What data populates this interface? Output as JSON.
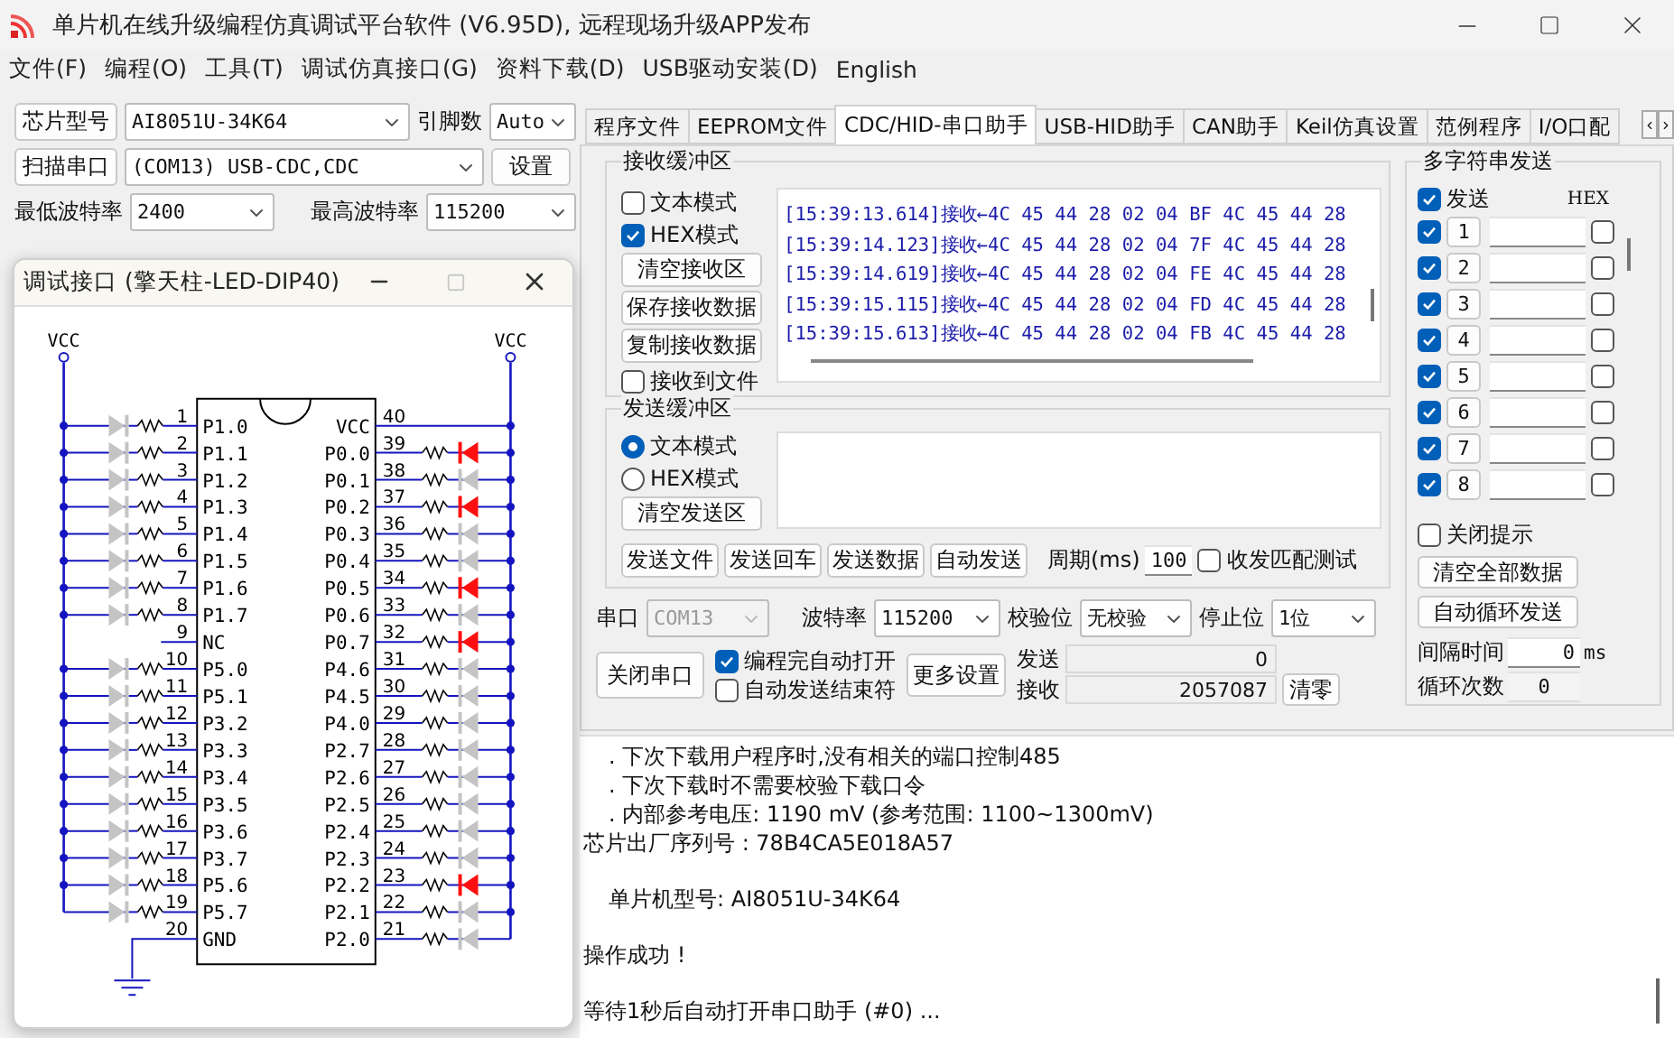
{
  "window": {
    "title": "单片机在线升级编程仿真调试平台软件 (V6.95D), 远程现场升级APP发布"
  },
  "menu": [
    "文件(F)",
    "编程(O)",
    "工具(T)",
    "调试仿真接口(G)",
    "资料下载(D)",
    "USB驱动安装(D)",
    "English"
  ],
  "left_panel": {
    "chip_button": "芯片型号",
    "chip_select": "AI8051U-34K64",
    "pin_count_label": "引脚数",
    "pin_count_select": "Auto",
    "scan_button": "扫描串口",
    "port_select": "(COM13) USB-CDC,CDC",
    "settings_button": "设置",
    "min_baud_label": "最低波特率",
    "min_baud_select": "2400",
    "max_baud_label": "最高波特率",
    "max_baud_select": "115200"
  },
  "debug_window": {
    "title": "调试接口 (擎天柱-LED-DIP40)",
    "vcc_labels": [
      "VCC",
      "VCC"
    ],
    "left_pins": [
      {
        "number": "1",
        "label": "P1.0",
        "kind": "led",
        "on": false
      },
      {
        "number": "2",
        "label": "P1.1",
        "kind": "led",
        "on": false
      },
      {
        "number": "3",
        "label": "P1.2",
        "kind": "led",
        "on": false
      },
      {
        "number": "4",
        "label": "P1.3",
        "kind": "led",
        "on": false
      },
      {
        "number": "5",
        "label": "P1.4",
        "kind": "led",
        "on": false
      },
      {
        "number": "6",
        "label": "P1.5",
        "kind": "led",
        "on": false
      },
      {
        "number": "7",
        "label": "P1.6",
        "kind": "led",
        "on": false
      },
      {
        "number": "8",
        "label": "P1.7",
        "kind": "led",
        "on": false
      },
      {
        "number": "9",
        "label": "NC",
        "kind": "open"
      },
      {
        "number": "10",
        "label": "P5.0",
        "kind": "led",
        "on": false
      },
      {
        "number": "11",
        "label": "P5.1",
        "kind": "led",
        "on": false
      },
      {
        "number": "12",
        "label": "P3.2",
        "kind": "led",
        "on": false
      },
      {
        "number": "13",
        "label": "P3.3",
        "kind": "led",
        "on": false
      },
      {
        "number": "14",
        "label": "P3.4",
        "kind": "led",
        "on": false
      },
      {
        "number": "15",
        "label": "P3.5",
        "kind": "led",
        "on": false
      },
      {
        "number": "16",
        "label": "P3.6",
        "kind": "led",
        "on": false
      },
      {
        "number": "17",
        "label": "P3.7",
        "kind": "led",
        "on": false
      },
      {
        "number": "18",
        "label": "P5.6",
        "kind": "led",
        "on": false
      },
      {
        "number": "19",
        "label": "P5.7",
        "kind": "led",
        "on": false
      },
      {
        "number": "20",
        "label": "GND",
        "kind": "ground"
      }
    ],
    "right_pins": [
      {
        "number": "40",
        "label": "VCC",
        "kind": "supply"
      },
      {
        "number": "39",
        "label": "P0.0",
        "kind": "led",
        "on": true
      },
      {
        "number": "38",
        "label": "P0.1",
        "kind": "led",
        "on": false
      },
      {
        "number": "37",
        "label": "P0.2",
        "kind": "led",
        "on": true
      },
      {
        "number": "36",
        "label": "P0.3",
        "kind": "led",
        "on": false
      },
      {
        "number": "35",
        "label": "P0.4",
        "kind": "led",
        "on": false
      },
      {
        "number": "34",
        "label": "P0.5",
        "kind": "led",
        "on": true
      },
      {
        "number": "33",
        "label": "P0.6",
        "kind": "led",
        "on": false
      },
      {
        "number": "32",
        "label": "P0.7",
        "kind": "led",
        "on": true
      },
      {
        "number": "31",
        "label": "P4.6",
        "kind": "led",
        "on": false
      },
      {
        "number": "30",
        "label": "P4.5",
        "kind": "led",
        "on": false
      },
      {
        "number": "29",
        "label": "P4.0",
        "kind": "led",
        "on": false
      },
      {
        "number": "28",
        "label": "P2.7",
        "kind": "led",
        "on": false
      },
      {
        "number": "27",
        "label": "P2.6",
        "kind": "led",
        "on": false
      },
      {
        "number": "26",
        "label": "P2.5",
        "kind": "led",
        "on": false
      },
      {
        "number": "25",
        "label": "P2.4",
        "kind": "led",
        "on": false
      },
      {
        "number": "24",
        "label": "P2.3",
        "kind": "led",
        "on": false
      },
      {
        "number": "23",
        "label": "P2.2",
        "kind": "led",
        "on": true
      },
      {
        "number": "22",
        "label": "P2.1",
        "kind": "led",
        "on": false
      },
      {
        "number": "21",
        "label": "P2.0",
        "kind": "led",
        "on": false
      }
    ]
  },
  "tabs": [
    {
      "label": "程序文件",
      "selected": false
    },
    {
      "label": "EEPROM文件",
      "selected": false
    },
    {
      "label": "CDC/HID-串口助手",
      "selected": true
    },
    {
      "label": "USB-HID助手",
      "selected": false
    },
    {
      "label": "CAN助手",
      "selected": false
    },
    {
      "label": "Keil仿真设置",
      "selected": false
    },
    {
      "label": "范例程序",
      "selected": false
    },
    {
      "label": "I/O口配",
      "selected": false
    }
  ],
  "receive": {
    "title": "接收缓冲区",
    "text_mode": {
      "label": "文本模式",
      "checked": false
    },
    "hex_mode": {
      "label": "HEX模式",
      "checked": true
    },
    "buttons": [
      "清空接收区",
      "保存接收数据",
      "复制接收数据"
    ],
    "to_file": {
      "label": "接收到文件",
      "checked": false
    },
    "lines": [
      "[15:39:13.614]接收←4C 45 44 28 02 04 BF 4C 45 44 28",
      "[15:39:14.123]接收←4C 45 44 28 02 04 7F 4C 45 44 28",
      "[15:39:14.619]接收←4C 45 44 28 02 04 FE 4C 45 44 28",
      "[15:39:15.115]接收←4C 45 44 28 02 04 FD 4C 45 44 28",
      "[15:39:15.613]接收←4C 45 44 28 02 04 FB 4C 45 44 28"
    ]
  },
  "send": {
    "title": "发送缓冲区",
    "modes": [
      {
        "label": "文本模式",
        "selected": true
      },
      {
        "label": "HEX模式",
        "selected": false
      }
    ],
    "clear_button": "清空发送区",
    "buttons": [
      "发送文件",
      "发送回车",
      "发送数据",
      "自动发送"
    ],
    "period_label": "周期(ms)",
    "period_value": "100",
    "match_test": {
      "label": "收发匹配测试",
      "checked": false
    }
  },
  "serial": {
    "port_label": "串口",
    "port_select": "COM13",
    "port_disabled": true,
    "baud_label": "波特率",
    "baud_select": "115200",
    "parity_label": "校验位",
    "parity_select": "无校验",
    "stop_label": "停止位",
    "stop_select": "1位",
    "close_button": "关闭串口",
    "auto_open": {
      "label": "编程完自动打开",
      "checked": true
    },
    "auto_end": {
      "label": "自动发送结束符",
      "checked": false
    },
    "more_button": "更多设置",
    "sent_label": "发送",
    "sent_value": "0",
    "received_label": "接收",
    "received_value": "2057087",
    "reset_button": "清零"
  },
  "multi_send": {
    "title": "多字符串发送",
    "send_all": {
      "label": "发送",
      "checked": true
    },
    "hex_header": "HEX",
    "rows": [
      {
        "number": "1",
        "checked": true,
        "hex": false
      },
      {
        "number": "2",
        "checked": true,
        "hex": false
      },
      {
        "number": "3",
        "checked": true,
        "hex": false
      },
      {
        "number": "4",
        "checked": true,
        "hex": false
      },
      {
        "number": "5",
        "checked": true,
        "hex": false
      },
      {
        "number": "6",
        "checked": true,
        "hex": false
      },
      {
        "number": "7",
        "checked": true,
        "hex": false
      },
      {
        "number": "8",
        "checked": true,
        "hex": false
      }
    ],
    "close_tips": {
      "label": "关闭提示",
      "checked": false
    },
    "clear_button": "清空全部数据",
    "loop_button": "自动循环发送",
    "interval_label": "间隔时间",
    "interval_value": "0",
    "interval_unit": "ms",
    "loop_count_label": "循环次数",
    "loop_count_value": "0"
  },
  "log": [
    {
      "text": ". 下次下载用户程序时,没有相关的端口控制485",
      "kind": "item"
    },
    {
      "text": ". 下次下载时不需要校验下载口令",
      "kind": "item"
    },
    {
      "text": ". 内部参考电压: 1190 mV (参考范围: 1100~1300mV)",
      "kind": "item"
    },
    {
      "text": "芯片出厂序列号 : 78B4CA5E018A57",
      "kind": "plain"
    },
    {
      "text": "单片机型号: AI8051U-34K64",
      "kind": "indented_paragraph"
    },
    {
      "text": "操作成功 !",
      "kind": "paragraph"
    },
    {
      "text": "等待1秒后自动打开串口助手 (#0) ...",
      "kind": "paragraph"
    }
  ]
}
